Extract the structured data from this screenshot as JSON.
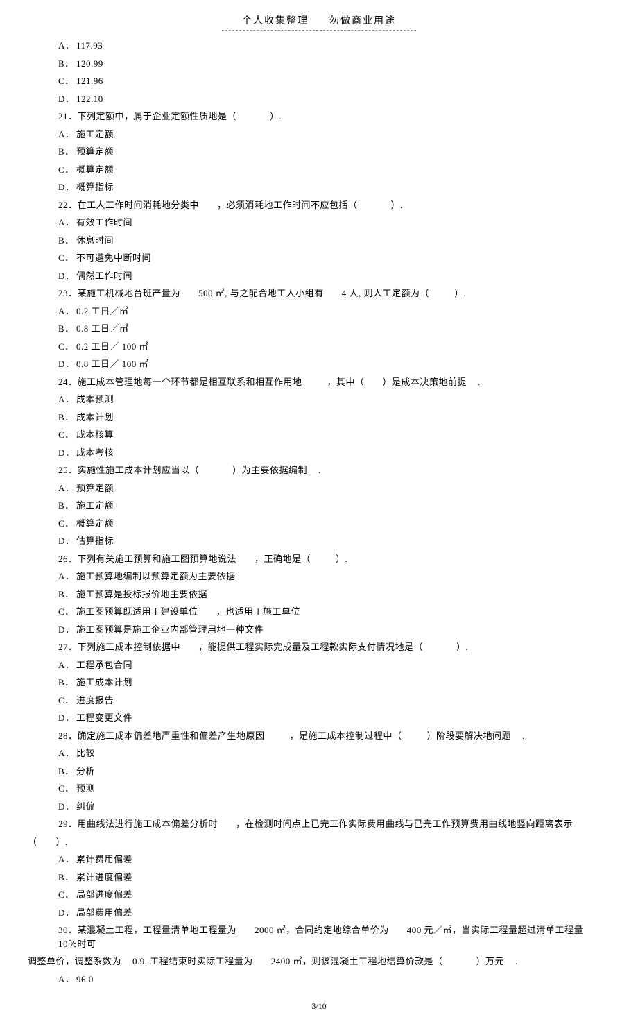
{
  "header": {
    "left": "个人收集整理",
    "right": "勿做商业用途"
  },
  "pager": "3/10",
  "prev": {
    "A": "117.93",
    "B": "120.99",
    "C": "121.96",
    "D": "122.10"
  },
  "q21": {
    "stem_a": "下列定额中，属于企业定额性质地是（",
    "stem_b": "）.",
    "A": "施工定额",
    "B": "预算定额",
    "C": "概算定额",
    "D": "概算指标"
  },
  "q22": {
    "stem_a": "在工人工作时间消耗地分类中",
    "stem_b": "，必须消耗地工作时间不应包括（",
    "stem_c": "）.",
    "A": "有效工作时间",
    "B": "休息时间",
    "C": "不可避免中断时间",
    "D": "偶然工作时间"
  },
  "q23": {
    "stem_a": "某施工机械地台班产量为",
    "stem_b": "500 ㎡, 与之配合地工人小组有",
    "stem_c": "4 人, 则人工定额为（",
    "stem_d": "）.",
    "A": "0.2 工日／㎡",
    "B": "0.8 工日／㎡",
    "C": "0.2 工日／ 100 ㎡",
    "D": "0.8 工日／ 100 ㎡"
  },
  "q24": {
    "stem_a": "施工成本管理地每一个环节都是相互联系和相互作用地",
    "stem_b": "，其中（",
    "stem_c": "）是成本决策地前提",
    "stem_d": ".",
    "A": "成本预测",
    "B": "成本计划",
    "C": "成本核算",
    "D": "成本考核"
  },
  "q25": {
    "stem_a": "实施性施工成本计划应当以（",
    "stem_b": "）为主要依据编制",
    "stem_c": ".",
    "A": "预算定额",
    "B": "施工定额",
    "C": "概算定额",
    "D": "估算指标"
  },
  "q26": {
    "stem_a": "下列有关施工预算和施工图预算地说法",
    "stem_b": "，正确地是（",
    "stem_c": "）.",
    "A": "施工预算地编制以预算定额为主要依据",
    "B": "施工预算是投标报价地主要依据",
    "C_a": "施工图预算既适用于建设单位",
    "C_b": "，也适用于施工单位",
    "D": "施工图预算是施工企业内部管理用地一种文件"
  },
  "q27": {
    "stem_a": "下列施工成本控制依据中",
    "stem_b": "，能提供工程实际完成量及工程款实际支付情况地是（",
    "stem_c": "）.",
    "A": "工程承包合同",
    "B": "施工成本计划",
    "C": "进度报告",
    "D": "工程变更文件"
  },
  "q28": {
    "stem_a": "确定施工成本偏差地严重性和偏差产生地原因",
    "stem_b": "，是施工成本控制过程中（",
    "stem_c": "）阶段要解决地问题",
    "stem_d": ".",
    "A": "比较",
    "B": "分析",
    "C": "预测",
    "D": "纠偏"
  },
  "q29": {
    "stem_a": "用曲线法进行施工成本偏差分析时",
    "stem_b": "，在检测时间点上已完工作实际费用曲线与已完工作预算费用曲线地竖向距离表示",
    "tail": "（　　）.",
    "A": "累计费用偏差",
    "B": "累计进度偏差",
    "C": "局部进度偏差",
    "D": "局部费用偏差"
  },
  "q30": {
    "stem_a": "某混凝土工程，工程量清单地工程量为",
    "stem_b": "2000 ㎡，合同约定地综合单价为",
    "stem_c": "400 元／㎡，当实际工程量超过清单工程量",
    "stem_d": "10％时可",
    "line2_a": "调整单价，调整系数为",
    "line2_b": "0.9. 工程结束时实际工程量为",
    "line2_c": "2400 ㎡，则该混凝土工程地结算价款是（",
    "line2_d": "）万元",
    "line2_e": ".",
    "A": "96.0"
  }
}
